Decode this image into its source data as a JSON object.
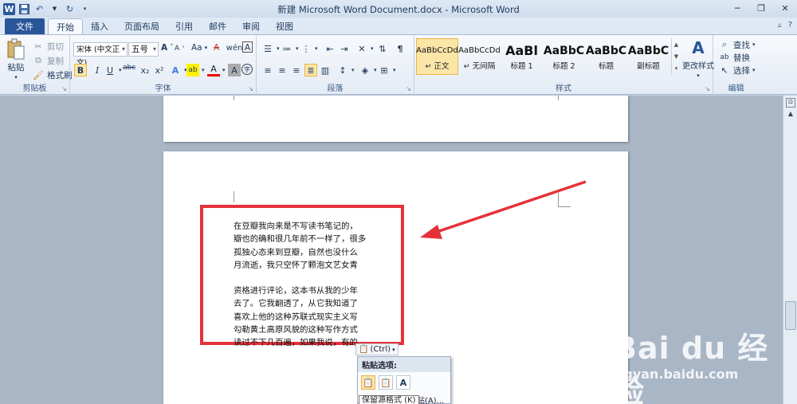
{
  "window": {
    "title": "新建 Microsoft Word Document.docx  -  Microsoft Word",
    "logo": "W"
  },
  "tabs": [
    {
      "label": "文件"
    },
    {
      "label": "开始"
    },
    {
      "label": "插入"
    },
    {
      "label": "页面布局"
    },
    {
      "label": "引用"
    },
    {
      "label": "邮件"
    },
    {
      "label": "审阅"
    },
    {
      "label": "视图"
    }
  ],
  "ribbon": {
    "clipboard": {
      "label": "剪贴板",
      "paste": "粘贴",
      "cut": "剪切",
      "copy": "复制",
      "format_painter": "格式刷"
    },
    "font": {
      "label": "字体",
      "font_name": "宋体 (中文正文)",
      "font_size": "五号",
      "bold": "B",
      "italic": "I",
      "underline": "U",
      "strike": "abc",
      "sub": "x₂",
      "sup": "x²",
      "grow": "A",
      "shrink": "A",
      "case": "Aa",
      "clear": "A",
      "highlight": "ab",
      "color": "A",
      "charshade": "A",
      "circled": "字"
    },
    "paragraph": {
      "label": "段落"
    },
    "styles": {
      "label": "样式",
      "items": [
        {
          "preview": "AaBbCcDd",
          "name": "正文"
        },
        {
          "preview": "AaBbCcDd",
          "name": "无间隔"
        },
        {
          "preview": "AaBl",
          "name": "标题 1"
        },
        {
          "preview": "AaBbC",
          "name": "标题 2"
        },
        {
          "preview": "AaBbC",
          "name": "标题"
        },
        {
          "preview": "AaBbC",
          "name": "副标题"
        }
      ],
      "change_styles": "更改样式"
    },
    "editing": {
      "label": "编辑",
      "find": "查找",
      "replace": "替换",
      "select": "选择"
    }
  },
  "document": {
    "lines_1": [
      "在豆瓣我向来是不写读书笔记的，",
      "瓣也的确和很几年前不一样了，很多",
      "孤独心态来到豆瓣，自然也没什么",
      "月流逝，我只空怀了颗泡文艺女青"
    ],
    "lines_2": [
      "资格进行评论，这本书从我的少年",
      "去了。它我翻透了，从它我知道了",
      "喜欢上他的这种苏联式现实主义写",
      "勾勒黄土高原风貌的这种写作方式",
      "读过不下几百遍，如果我说，有的"
    ]
  },
  "paste_options": {
    "tag": "(Ctrl)",
    "header": "粘贴选项:",
    "item": "设置默认粘贴(A)...",
    "tooltip": "保留源格式 (K)"
  },
  "watermark": {
    "main": "Bai du 经验",
    "sub": "jingyan.baidu.com"
  },
  "colors": {
    "accent": "#2a5699",
    "highlight_box": "#e5323a",
    "ribbon_bg": "#e4ebf5"
  }
}
